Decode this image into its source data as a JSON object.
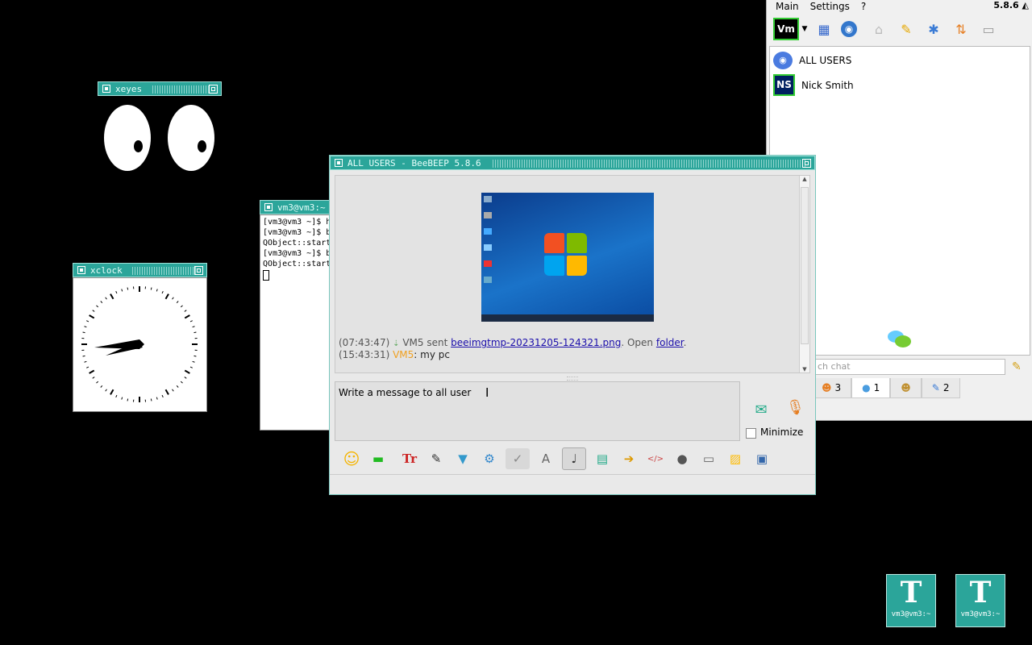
{
  "xeyes": {
    "title": "xeyes"
  },
  "xclock": {
    "title": "xclock"
  },
  "terminal": {
    "title": "vm3@vm3:~",
    "lines": [
      "[vm3@vm3 ~]$ h",
      "[vm3@vm3 ~]$ b",
      "QObject::start",
      "[vm3@vm3 ~]$ b",
      "QObject::start"
    ]
  },
  "beebeep_main": {
    "menu": [
      "Main",
      "Settings",
      "?"
    ],
    "version": "5.8.6",
    "toolbar_icons": [
      "vm-status-icon",
      "dropdown-arrow-icon",
      "edit-profile-icon",
      "network-icon",
      "home-icon",
      "pencil-icon",
      "tools-icon",
      "update-icon",
      "trash-icon"
    ],
    "vm_label": "Vm",
    "users": [
      {
        "name": "ALL USERS",
        "icon": "all-users-icon"
      },
      {
        "name": "Nick Smith",
        "initials": "NS",
        "icon": "user-avatar"
      }
    ],
    "search_placeholder": "ch chat",
    "tabs": [
      {
        "icon": "users-icon",
        "count": "3"
      },
      {
        "icon": "chat-icon",
        "count": "1"
      },
      {
        "icon": "groups-icon",
        "count": ""
      },
      {
        "icon": "files-icon",
        "count": "2"
      }
    ]
  },
  "chat_window": {
    "title": "ALL USERS - BeeBEEP 5.8.6",
    "messages": {
      "line1_time": "(07:43:47)",
      "line1_user": "VM5 sent",
      "line1_file": "beeimgtmp-20231205-124321.png",
      "line1_open": ". Open",
      "line1_folder": "folder",
      "line1_end": ".",
      "line2_time": "(15:43:31)",
      "line2_user": "VM5",
      "line2_text": ": my pc"
    },
    "input_placeholder": "Write a message to all user",
    "minimize_label": "Minimize",
    "toolbar_icons": [
      "emoji-icon",
      "highlight-icon",
      "font-icon",
      "draw-icon",
      "filter-icon",
      "settings-icon",
      "spellcheck-icon",
      "font-size-icon",
      "music-note-icon",
      "save-icon",
      "send-file-icon",
      "code-icon",
      "record-icon",
      "screen-icon",
      "note-icon",
      "save-chat-icon"
    ]
  },
  "desktop_icons": [
    {
      "label": "vm3@vm3:~"
    },
    {
      "label": "vm3@vm3:~"
    }
  ],
  "colors": {
    "twm_title": "#2ba59a",
    "link": "#1a0dab",
    "vm5_name": "#f0a020"
  }
}
